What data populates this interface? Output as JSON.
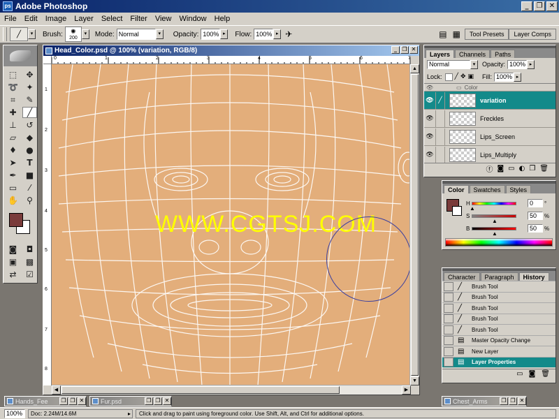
{
  "app": {
    "title": "Adobe Photoshop",
    "icon": "ps"
  },
  "window_buttons": {
    "minimize": "_",
    "restore": "❐",
    "close": "✕"
  },
  "menu": [
    "File",
    "Edit",
    "Image",
    "Layer",
    "Select",
    "Filter",
    "View",
    "Window",
    "Help"
  ],
  "options": {
    "brush_label": "Brush:",
    "brush_size": "200",
    "mode_label": "Mode:",
    "mode_value": "Normal",
    "opacity_label": "Opacity:",
    "opacity_value": "100%",
    "flow_label": "Flow:",
    "flow_value": "100%",
    "tabs": [
      "Tool Presets",
      "Layer Comps"
    ]
  },
  "document": {
    "title": "Head_Color.psd @ 100% (variation, RGB/8)",
    "ruler_top": [
      "0",
      "1",
      "2",
      "3",
      "4",
      "5",
      "6",
      "7"
    ],
    "ruler_left": [
      "1",
      "2",
      "3",
      "4",
      "5",
      "6",
      "7",
      "8"
    ],
    "watermark": "WWW.CGTSJ.COM",
    "canvas_color": "#e3ae7b",
    "wire_color": "#ffffff"
  },
  "layers_panel": {
    "tabs": [
      "Layers",
      "Channels",
      "Paths"
    ],
    "blend_mode": "Normal",
    "opacity_label": "Opacity:",
    "opacity_value": "100%",
    "lock_label": "Lock:",
    "fill_label": "Fill:",
    "fill_value": "100%",
    "group_name": "Color",
    "layers": [
      {
        "name": "variation",
        "selected": true
      },
      {
        "name": "Freckles",
        "selected": false
      },
      {
        "name": "Lips_Screen",
        "selected": false
      },
      {
        "name": "Lips_Multiply",
        "selected": false
      }
    ]
  },
  "color_panel": {
    "tabs": [
      "Color",
      "Swatches",
      "Styles"
    ],
    "channels": [
      {
        "label": "H",
        "value": "0",
        "unit": "°",
        "level": 0.0
      },
      {
        "label": "S",
        "value": "50",
        "unit": "%",
        "level": 0.5
      },
      {
        "label": "B",
        "value": "50",
        "unit": "%",
        "level": 0.5
      }
    ],
    "foreground": "#7a3b3a"
  },
  "history_panel": {
    "tabs": [
      "Character",
      "Paragraph",
      "History"
    ],
    "items": [
      {
        "label": "Brush Tool",
        "icon": "brush-icon",
        "selected": false
      },
      {
        "label": "Brush Tool",
        "icon": "brush-icon",
        "selected": false
      },
      {
        "label": "Brush Tool",
        "icon": "brush-icon",
        "selected": false
      },
      {
        "label": "Brush Tool",
        "icon": "brush-icon",
        "selected": false
      },
      {
        "label": "Brush Tool",
        "icon": "brush-icon",
        "selected": false
      },
      {
        "label": "Master Opacity Change",
        "icon": "document-icon",
        "selected": false
      },
      {
        "label": "New Layer",
        "icon": "document-icon",
        "selected": false
      },
      {
        "label": "Layer Properties",
        "icon": "document-icon",
        "selected": true
      }
    ]
  },
  "minimized": [
    {
      "title": "Hands_Fee"
    },
    {
      "title": "Fur.psd"
    },
    {
      "title": "Chest_Arms"
    }
  ],
  "status": {
    "zoom": "100%",
    "doc": "Doc: 2.24M/14.6M",
    "hint": "Click and drag to paint using foreground color.  Use Shift, Alt, and Ctrl for additional options."
  }
}
